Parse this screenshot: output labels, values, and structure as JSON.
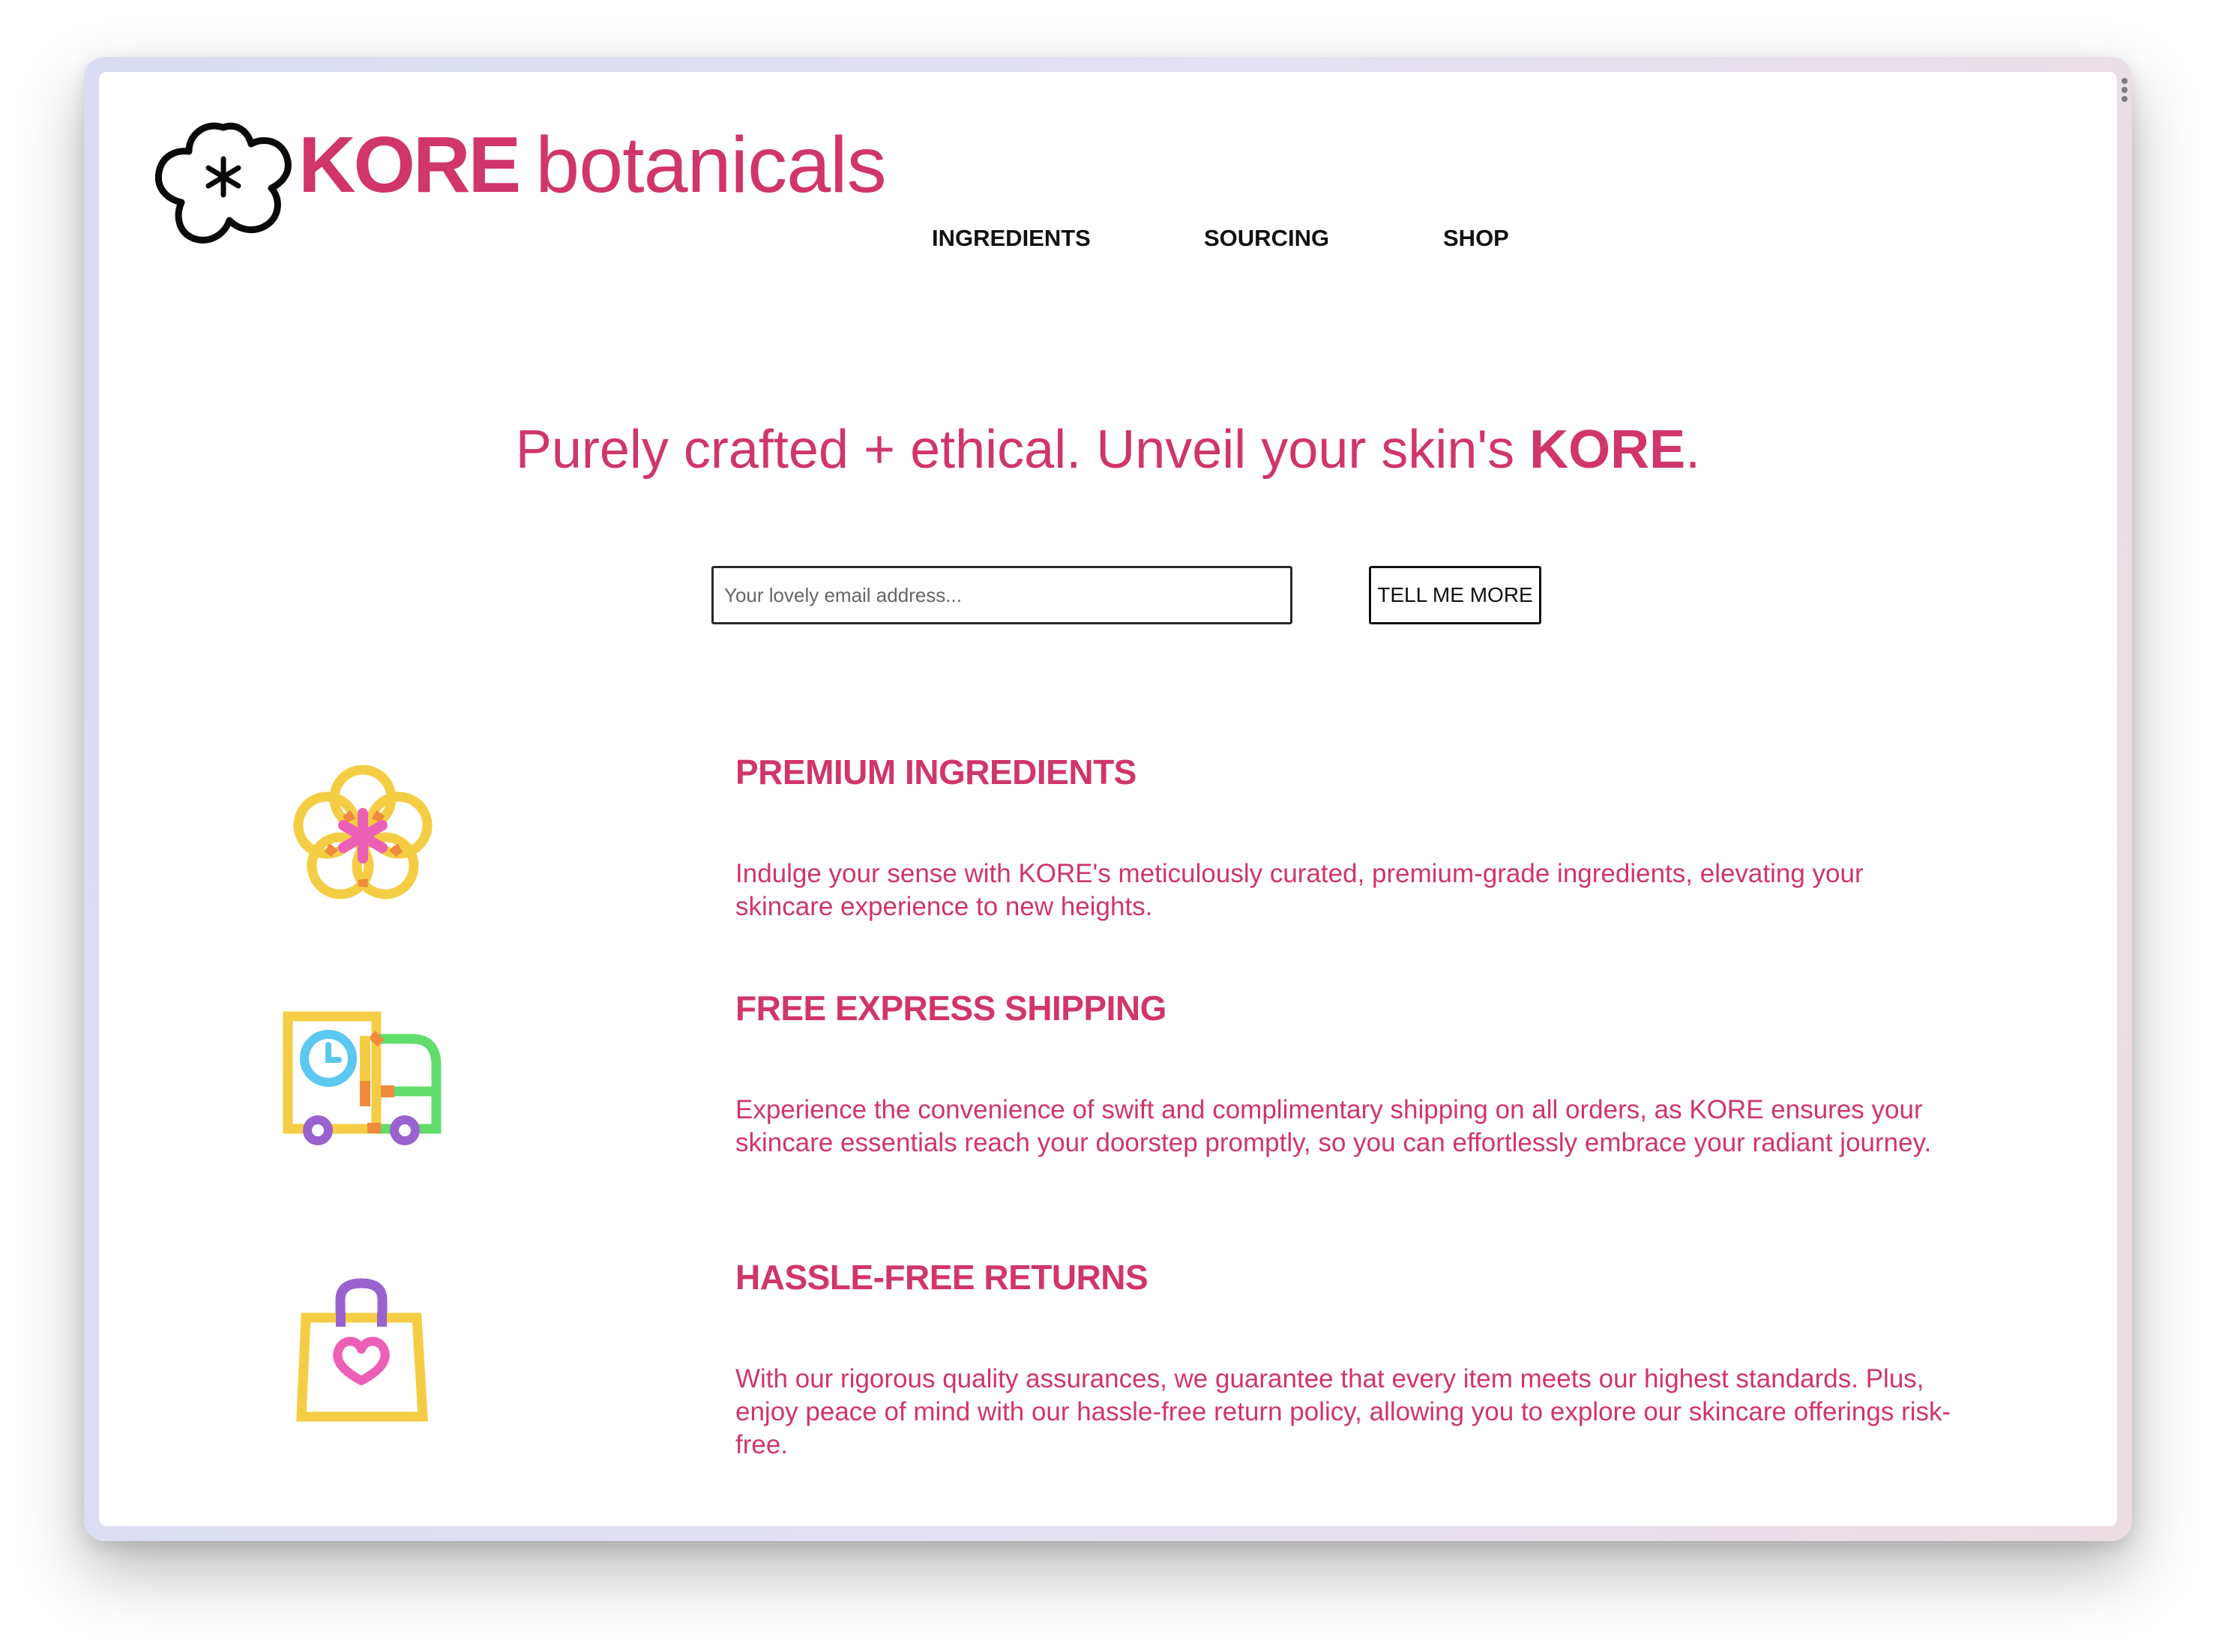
{
  "brand": {
    "name_bold": "KORE",
    "name_light": "botanicals",
    "logo_icon": "flower-asterisk-icon",
    "color": "#d0356b"
  },
  "nav": {
    "items": [
      {
        "label": "INGREDIENTS"
      },
      {
        "label": "SOURCING"
      },
      {
        "label": "SHOP"
      }
    ]
  },
  "hero": {
    "headline_prefix": "Purely crafted + ethical. Unveil your skin's ",
    "headline_emphasis": "KORE",
    "headline_suffix": "."
  },
  "signup": {
    "email_placeholder": "Your lovely email address...",
    "email_value": "",
    "button_label": "TELL ME MORE"
  },
  "features": [
    {
      "icon": "flower-icon",
      "title": "PREMIUM INGREDIENTS",
      "body": "Indulge your sense with KORE's meticulously curated, premium-grade ingredients, elevating your skincare experience to new heights."
    },
    {
      "icon": "delivery-truck-icon",
      "title": "FREE EXPRESS SHIPPING",
      "body": "Experience the convenience of swift and complimentary shipping on all orders, as KORE ensures your skincare essentials reach your doorstep promptly, so you can effortlessly embrace your radiant journey."
    },
    {
      "icon": "shopping-bag-heart-icon",
      "title": "HASSLE-FREE RETURNS",
      "body": "With our rigorous quality assurances, we guarantee that every item meets our highest standards. Plus, enjoy peace of mind with our hassle-free return policy, allowing you to explore our skincare offerings risk-free."
    }
  ],
  "colors": {
    "accent": "#d0356b",
    "nav_text": "#111111",
    "icon_yellow": "#f5cd45",
    "icon_pink": "#ec5fb6",
    "icon_orange": "#f08a3c",
    "icon_blue": "#5bc8f0",
    "icon_green": "#62dc6a",
    "icon_purple": "#9a62cf"
  }
}
